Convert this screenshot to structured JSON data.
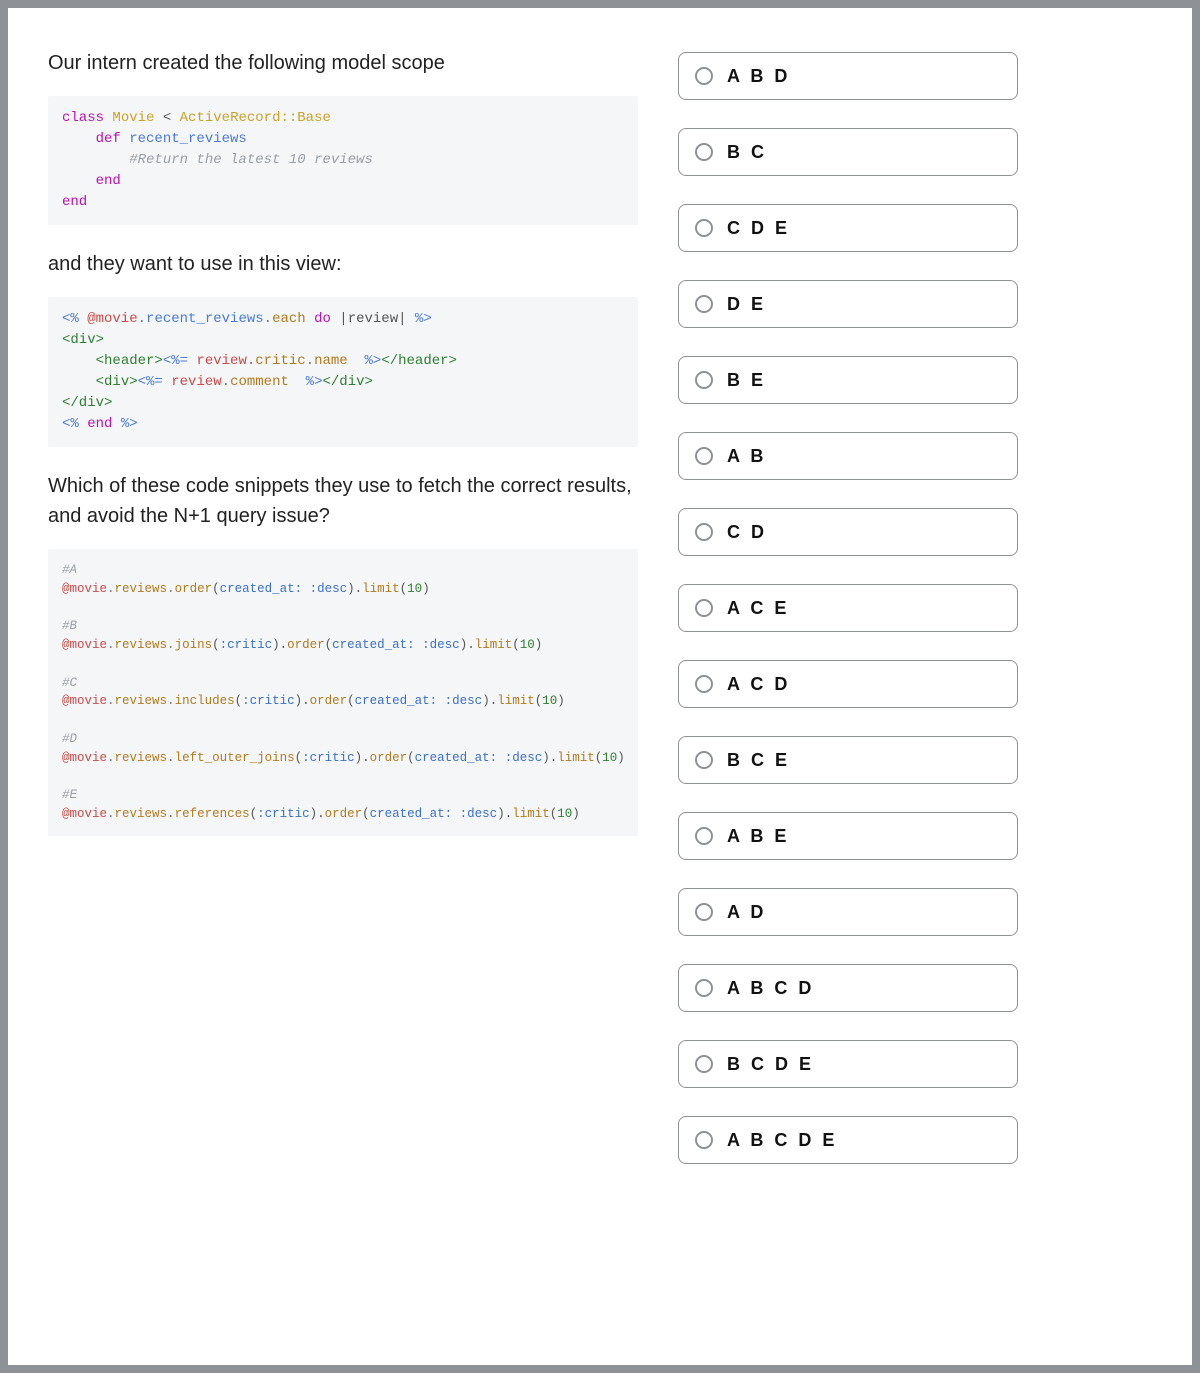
{
  "question": {
    "intro": "Our intern created the following model scope",
    "code1_lines": [
      [
        {
          "t": "class ",
          "c": "kw"
        },
        {
          "t": "Movie",
          "c": "cls"
        },
        {
          "t": " < ",
          "c": "pun"
        },
        {
          "t": "ActiveRecord::Base",
          "c": "cls"
        }
      ],
      [
        {
          "t": "    ",
          "c": ""
        },
        {
          "t": "def ",
          "c": "kw"
        },
        {
          "t": "recent_reviews",
          "c": "def"
        }
      ],
      [
        {
          "t": "        ",
          "c": ""
        },
        {
          "t": "#Return the latest 10 reviews",
          "c": "cmt"
        }
      ],
      [
        {
          "t": "    ",
          "c": ""
        },
        {
          "t": "end",
          "c": "kw"
        }
      ],
      [
        {
          "t": "end",
          "c": "kw"
        }
      ]
    ],
    "middle": "and they want to use in this view:",
    "code2_lines": [
      [
        {
          "t": "<% ",
          "c": "erb"
        },
        {
          "t": "@movie",
          "c": "var"
        },
        {
          "t": ".",
          "c": "dot"
        },
        {
          "t": "recent_reviews",
          "c": "def"
        },
        {
          "t": ".",
          "c": "dot"
        },
        {
          "t": "each",
          "c": "meth"
        },
        {
          "t": " do ",
          "c": "kw"
        },
        {
          "t": "|review|",
          "c": "pun"
        },
        {
          "t": " %>",
          "c": "erb"
        }
      ],
      [
        {
          "t": "<div>",
          "c": "tag"
        }
      ],
      [
        {
          "t": "    ",
          "c": ""
        },
        {
          "t": "<header>",
          "c": "tag"
        },
        {
          "t": "<%= ",
          "c": "erb"
        },
        {
          "t": "review",
          "c": "var"
        },
        {
          "t": ".",
          "c": "dot"
        },
        {
          "t": "critic",
          "c": "meth"
        },
        {
          "t": ".",
          "c": "dot"
        },
        {
          "t": "name",
          "c": "meth"
        },
        {
          "t": "  %>",
          "c": "erb"
        },
        {
          "t": "</header>",
          "c": "tag"
        }
      ],
      [
        {
          "t": "    ",
          "c": ""
        },
        {
          "t": "<div>",
          "c": "tag"
        },
        {
          "t": "<%= ",
          "c": "erb"
        },
        {
          "t": "review",
          "c": "var"
        },
        {
          "t": ".",
          "c": "dot"
        },
        {
          "t": "comment",
          "c": "meth"
        },
        {
          "t": "  %>",
          "c": "erb"
        },
        {
          "t": "</div>",
          "c": "tag"
        }
      ],
      [
        {
          "t": "</div>",
          "c": "tag"
        }
      ],
      [
        {
          "t": "<% ",
          "c": "erb"
        },
        {
          "t": "end",
          "c": "kw"
        },
        {
          "t": " %>",
          "c": "erb"
        }
      ]
    ],
    "ask": "Which of these code snippets they use to fetch the correct results, and avoid the N+1 query issue?",
    "code3_lines": [
      [
        {
          "t": "#A",
          "c": "cmt"
        }
      ],
      [
        {
          "t": "@movie",
          "c": "var"
        },
        {
          "t": ".",
          "c": "dot"
        },
        {
          "t": "reviews",
          "c": "meth"
        },
        {
          "t": ".",
          "c": "dot"
        },
        {
          "t": "order",
          "c": "meth"
        },
        {
          "t": "(",
          "c": "pun"
        },
        {
          "t": "created_at: ",
          "c": "sym"
        },
        {
          "t": ":desc",
          "c": "sym"
        },
        {
          "t": ").",
          "c": "pun"
        },
        {
          "t": "limit",
          "c": "meth"
        },
        {
          "t": "(",
          "c": "pun"
        },
        {
          "t": "10",
          "c": "num"
        },
        {
          "t": ")",
          "c": "pun"
        }
      ],
      [
        {
          "t": "",
          "c": ""
        }
      ],
      [
        {
          "t": "#B",
          "c": "cmt"
        }
      ],
      [
        {
          "t": "@movie",
          "c": "var"
        },
        {
          "t": ".",
          "c": "dot"
        },
        {
          "t": "reviews",
          "c": "meth"
        },
        {
          "t": ".",
          "c": "dot"
        },
        {
          "t": "joins",
          "c": "meth"
        },
        {
          "t": "(",
          "c": "pun"
        },
        {
          "t": ":critic",
          "c": "sym"
        },
        {
          "t": ").",
          "c": "pun"
        },
        {
          "t": "order",
          "c": "meth"
        },
        {
          "t": "(",
          "c": "pun"
        },
        {
          "t": "created_at: ",
          "c": "sym"
        },
        {
          "t": ":desc",
          "c": "sym"
        },
        {
          "t": ").",
          "c": "pun"
        },
        {
          "t": "limit",
          "c": "meth"
        },
        {
          "t": "(",
          "c": "pun"
        },
        {
          "t": "10",
          "c": "num"
        },
        {
          "t": ")",
          "c": "pun"
        }
      ],
      [
        {
          "t": "",
          "c": ""
        }
      ],
      [
        {
          "t": "#C",
          "c": "cmt"
        }
      ],
      [
        {
          "t": "@movie",
          "c": "var"
        },
        {
          "t": ".",
          "c": "dot"
        },
        {
          "t": "reviews",
          "c": "meth"
        },
        {
          "t": ".",
          "c": "dot"
        },
        {
          "t": "includes",
          "c": "meth"
        },
        {
          "t": "(",
          "c": "pun"
        },
        {
          "t": ":critic",
          "c": "sym"
        },
        {
          "t": ").",
          "c": "pun"
        },
        {
          "t": "order",
          "c": "meth"
        },
        {
          "t": "(",
          "c": "pun"
        },
        {
          "t": "created_at: ",
          "c": "sym"
        },
        {
          "t": ":desc",
          "c": "sym"
        },
        {
          "t": ").",
          "c": "pun"
        },
        {
          "t": "limit",
          "c": "meth"
        },
        {
          "t": "(",
          "c": "pun"
        },
        {
          "t": "10",
          "c": "num"
        },
        {
          "t": ")",
          "c": "pun"
        }
      ],
      [
        {
          "t": "",
          "c": ""
        }
      ],
      [
        {
          "t": "#D",
          "c": "cmt"
        }
      ],
      [
        {
          "t": "@movie",
          "c": "var"
        },
        {
          "t": ".",
          "c": "dot"
        },
        {
          "t": "reviews",
          "c": "meth"
        },
        {
          "t": ".",
          "c": "dot"
        },
        {
          "t": "left_outer_joins",
          "c": "meth"
        },
        {
          "t": "(",
          "c": "pun"
        },
        {
          "t": ":critic",
          "c": "sym"
        },
        {
          "t": ").",
          "c": "pun"
        },
        {
          "t": "order",
          "c": "meth"
        },
        {
          "t": "(",
          "c": "pun"
        },
        {
          "t": "created_at: ",
          "c": "sym"
        },
        {
          "t": ":desc",
          "c": "sym"
        },
        {
          "t": ").",
          "c": "pun"
        },
        {
          "t": "limit",
          "c": "meth"
        },
        {
          "t": "(",
          "c": "pun"
        },
        {
          "t": "10",
          "c": "num"
        },
        {
          "t": ")",
          "c": "pun"
        }
      ],
      [
        {
          "t": "",
          "c": ""
        }
      ],
      [
        {
          "t": "#E",
          "c": "cmt"
        }
      ],
      [
        {
          "t": "@movie",
          "c": "var"
        },
        {
          "t": ".",
          "c": "dot"
        },
        {
          "t": "reviews",
          "c": "meth"
        },
        {
          "t": ".",
          "c": "dot"
        },
        {
          "t": "references",
          "c": "meth"
        },
        {
          "t": "(",
          "c": "pun"
        },
        {
          "t": ":critic",
          "c": "sym"
        },
        {
          "t": ").",
          "c": "pun"
        },
        {
          "t": "order",
          "c": "meth"
        },
        {
          "t": "(",
          "c": "pun"
        },
        {
          "t": "created_at: ",
          "c": "sym"
        },
        {
          "t": ":desc",
          "c": "sym"
        },
        {
          "t": ").",
          "c": "pun"
        },
        {
          "t": "limit",
          "c": "meth"
        },
        {
          "t": "(",
          "c": "pun"
        },
        {
          "t": "10",
          "c": "num"
        },
        {
          "t": ")",
          "c": "pun"
        }
      ]
    ]
  },
  "options": [
    "A B D",
    "B C",
    "C D E",
    "D E",
    "B E",
    "A B",
    "C D",
    "A C E",
    "A C D",
    "B C E",
    "A B E",
    "A D",
    "A B C D",
    "B C D E",
    "A B C D E"
  ]
}
